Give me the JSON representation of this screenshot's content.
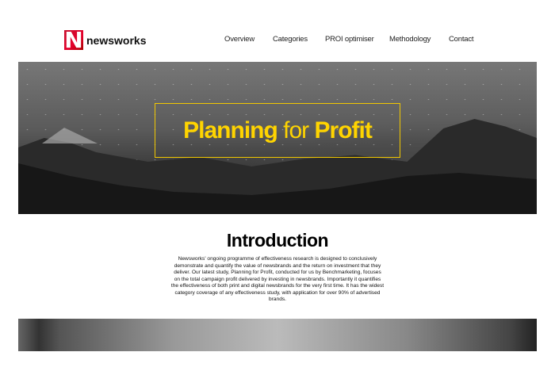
{
  "brand": {
    "mark": "N",
    "name": "newsworks"
  },
  "nav": [
    {
      "label": "Overview"
    },
    {
      "label": "Categories"
    },
    {
      "label": "PROI optimiser"
    },
    {
      "label": "Methodology"
    },
    {
      "label": "Contact"
    }
  ],
  "hero": {
    "title_part1": "Planning",
    "title_part2": "for",
    "title_part3": "Profit",
    "accent": "#ffd400"
  },
  "intro": {
    "title": "Introduction",
    "body": "Newsworks' ongoing programme of effectiveness research is designed to conclusively demonstrate and quantify the value of newsbrands and the return on investment that they deliver. Our latest study, Planning for Profit, conducted for us by Benchmarketing, focuses on the total campaign profit delivered by investing in newsbrands.  Importantly it quantifies the effectiveness of both print and digital newsbrands for the very first time. It has the widest category coverage of any effectiveness study, with application for over 90% of advertised brands."
  }
}
